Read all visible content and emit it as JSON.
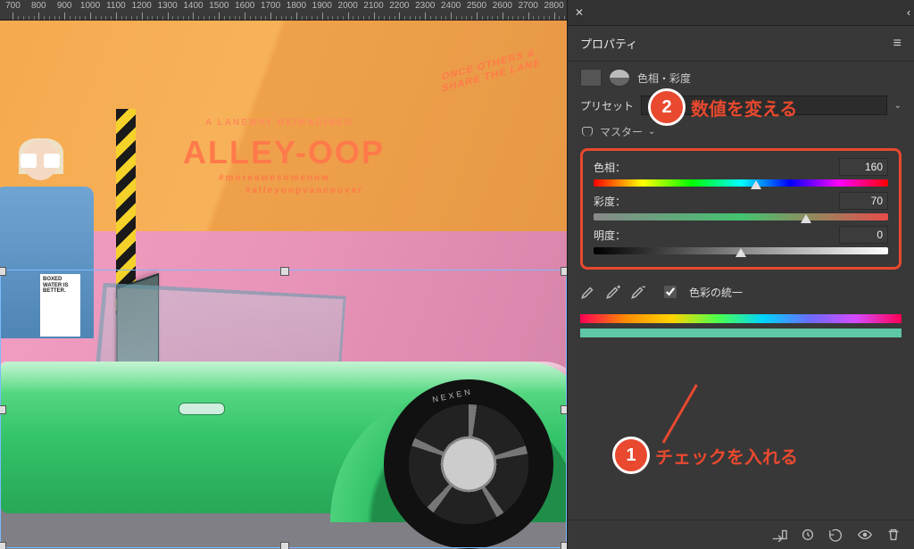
{
  "ruler": {
    "start": 700,
    "step": 100,
    "end": 2800
  },
  "panel": {
    "title": "プロパティ",
    "adjustment_label": "色相・彩度",
    "preset_label": "プリセット",
    "master_label": "マスター",
    "sliders": {
      "hue": {
        "label": "色相：",
        "value": "160",
        "pos_pct": 55
      },
      "sat": {
        "label": "彩度：",
        "value": "70",
        "pos_pct": 72
      },
      "lig": {
        "label": "明度：",
        "value": "0",
        "pos_pct": 50
      }
    },
    "colorize_label": "色彩の統一",
    "colorize_checked": true
  },
  "annotations": {
    "a1": {
      "num": "1",
      "text": "チェックを入れる"
    },
    "a2": {
      "num": "2",
      "text": "数値を変える"
    }
  },
  "image_text": {
    "sign1": "A LANEWAY REIMAGINED",
    "sign2": "ALLEY-OOP",
    "sign3": "#moreawesomenow",
    "sign4": "#alleyoopvancouver",
    "cube": "ONCE\nOTHERS\n& SHARE\nTHE LANE",
    "box": "BOXED\nWATER\nIS\nBETTER.",
    "tire": "NEXEN"
  }
}
